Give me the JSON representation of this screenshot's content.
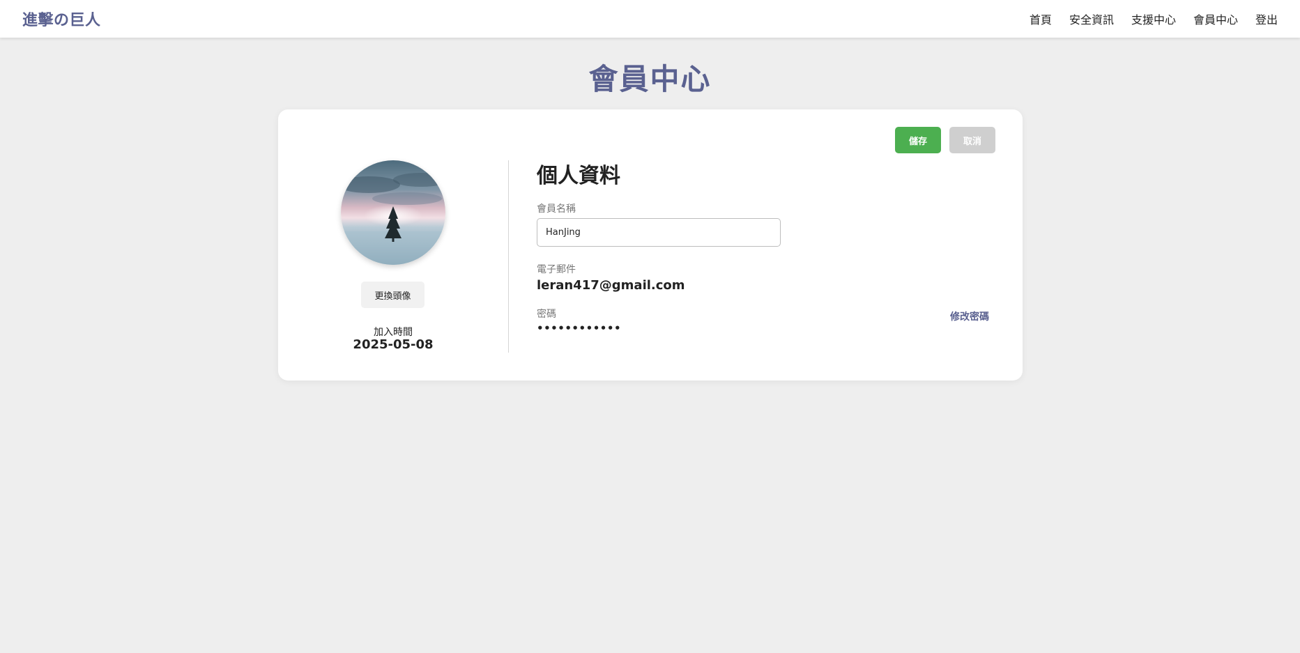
{
  "header": {
    "brand": "進擊の巨人",
    "nav": [
      "首頁",
      "安全資訊",
      "支援中心",
      "會員中心",
      "登出"
    ]
  },
  "page": {
    "title": "會員中心"
  },
  "card": {
    "buttons": {
      "save": "儲存",
      "cancel": "取消"
    },
    "avatar": {
      "image": "winter-tree-photo",
      "change_label": "更換頭像"
    },
    "join": {
      "label": "加入時間",
      "date": "2025-05-08"
    },
    "profile": {
      "title": "個人資料",
      "name_label": "會員名稱",
      "name_value": "HanJing",
      "email_label": "電子郵件",
      "email_value": "leran417@gmail.com",
      "password_label": "密碼",
      "password_value": "••••••••••••",
      "change_password": "修改密碼"
    }
  },
  "colors": {
    "brand": "#5a6190",
    "save": "#4caf50",
    "cancel": "#cfcfcf",
    "background": "#eeeeee"
  }
}
